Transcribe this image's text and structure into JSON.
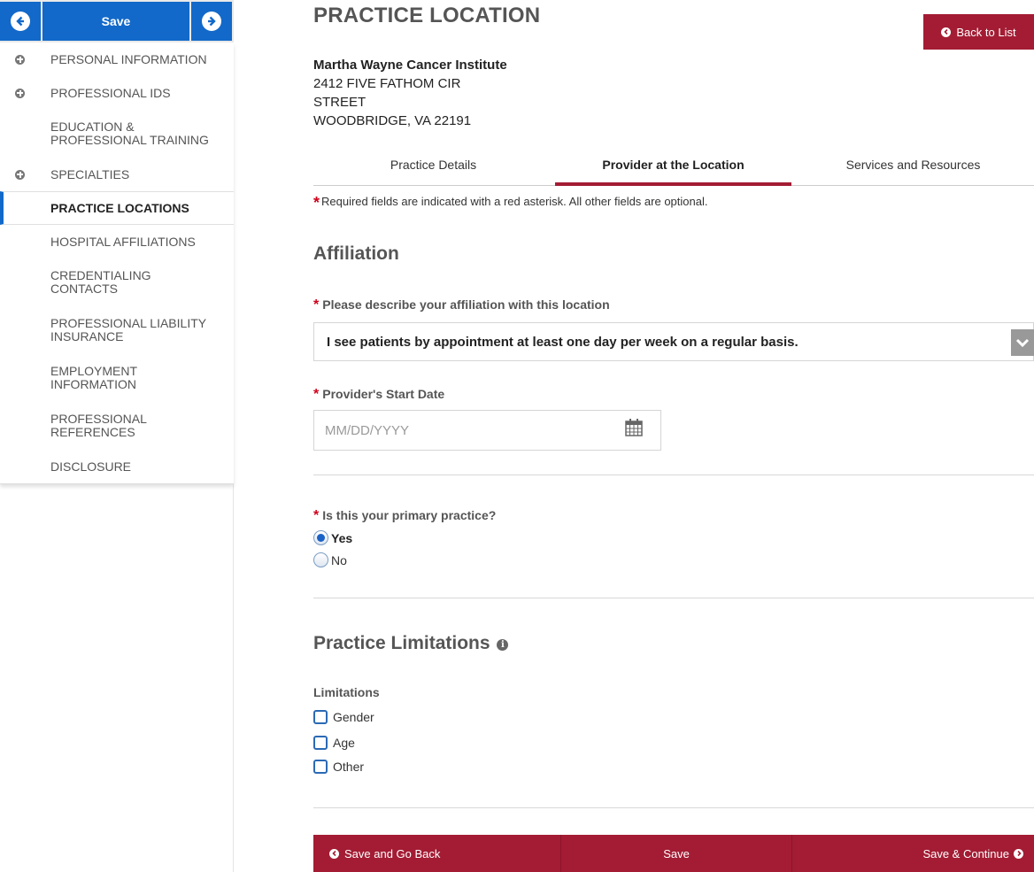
{
  "sidebar": {
    "save_label": "Save",
    "items": [
      {
        "label": "PERSONAL INFORMATION",
        "expandable": true
      },
      {
        "label": "PROFESSIONAL IDS",
        "expandable": true
      },
      {
        "label": "EDUCATION & PROFESSIONAL TRAINING",
        "expandable": false
      },
      {
        "label": "SPECIALTIES",
        "expandable": true
      },
      {
        "label": "PRACTICE LOCATIONS",
        "expandable": false,
        "active": true
      },
      {
        "label": "HOSPITAL AFFILIATIONS",
        "expandable": false
      },
      {
        "label": "CREDENTIALING CONTACTS",
        "expandable": false
      },
      {
        "label": "PROFESSIONAL LIABILITY INSURANCE",
        "expandable": false
      },
      {
        "label": "EMPLOYMENT INFORMATION",
        "expandable": false
      },
      {
        "label": "PROFESSIONAL REFERENCES",
        "expandable": false
      },
      {
        "label": "DISCLOSURE",
        "expandable": false
      }
    ]
  },
  "header": {
    "title": "PRACTICE LOCATION",
    "back_label": "Back to List"
  },
  "location": {
    "name": "Martha Wayne Cancer Institute",
    "line1": "2412 FIVE FATHOM CIR",
    "line2": "STREET",
    "line3": "WOODBRIDGE, VA 22191"
  },
  "tabs": [
    {
      "label": "Practice Details",
      "active": false
    },
    {
      "label": "Provider at the Location",
      "active": true
    },
    {
      "label": "Services and Resources",
      "active": false
    }
  ],
  "required_note": {
    "asterisk": "*",
    "text": "Required fields are indicated with a red asterisk. All other fields are optional."
  },
  "affiliation": {
    "section_title": "Affiliation",
    "describe_label": "Please describe your affiliation with this location",
    "describe_value": "I see patients by appointment at least one day per week on a regular basis.",
    "start_date_label": "Provider's Start Date",
    "start_date_placeholder": "MM/DD/YYYY",
    "start_date_value": "",
    "primary_label": "Is this your primary practice?",
    "primary_options": [
      {
        "label": "Yes",
        "selected": true
      },
      {
        "label": "No",
        "selected": false
      }
    ]
  },
  "limitations": {
    "section_title": "Practice Limitations",
    "group_label": "Limitations",
    "options": [
      {
        "label": "Gender",
        "checked": false
      },
      {
        "label": "Age",
        "checked": false
      },
      {
        "label": "Other",
        "checked": false
      }
    ]
  },
  "footer": {
    "back_label": "Save and Go Back",
    "save_label": "Save",
    "continue_label": "Save & Continue"
  },
  "colors": {
    "primary_blue": "#1269c9",
    "accent_red": "#a31c33",
    "required_red": "#d0021b"
  },
  "icons": {
    "prev": "arrow-left-circle-icon",
    "next": "arrow-right-circle-icon",
    "back_list": "chevron-left-circle-icon",
    "dropdown": "chevron-down-icon",
    "calendar": "calendar-icon",
    "info": "info-icon"
  }
}
